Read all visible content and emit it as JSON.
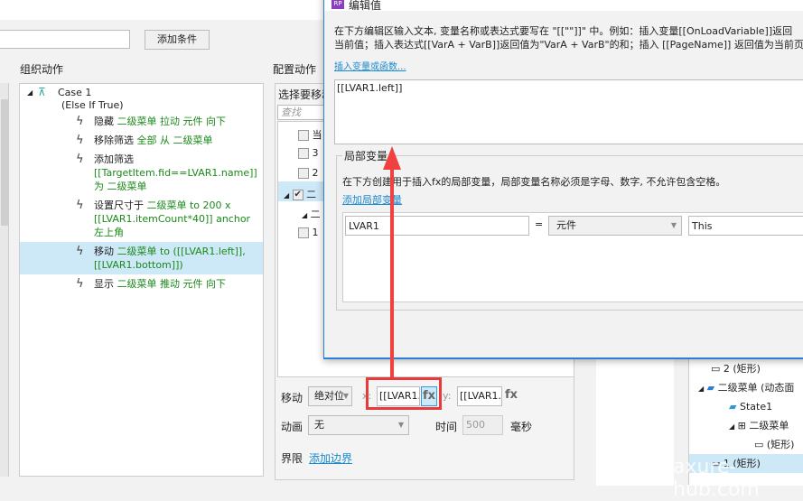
{
  "toolbar": {
    "add_condition": "添加条件"
  },
  "left": {
    "title": "组织动作",
    "case_title": "Case 1",
    "case_cond": "(Else If True)",
    "actions": [
      {
        "verb": "隐藏",
        "rest": "二级菜单 拉动 元件 向下",
        "rest2": ""
      },
      {
        "verb": "移除筛选",
        "rest": "全部 从 二级菜单",
        "rest2": ""
      },
      {
        "verb": "添加筛选",
        "rest": "[[TargetItem.fid==LVAR1.name]]",
        "rest2": "为 二级菜单"
      },
      {
        "verb": "设置尺寸于",
        "rest": "二级菜单 to 200 x",
        "rest2": "[[LVAR1.itemCount*40]] anchor 左上角"
      },
      {
        "verb": "移动",
        "rest": "二级菜单 to ([[LVAR1.left]],",
        "rest2": "[[LVAR1.bottom]])"
      },
      {
        "verb": "显示",
        "rest": "二级菜单 推动 元件 向下",
        "rest2": ""
      }
    ]
  },
  "config": {
    "title": "配置动作",
    "select_label": "选择要移动",
    "search_placeholder": "查找",
    "items": [
      "当",
      "3",
      "2",
      "二",
      "二",
      "1"
    ],
    "move_label": "移动",
    "move_mode": "绝对位",
    "x_label": "x:",
    "x_value": "[[LVAR1.",
    "fx": "fx",
    "y_label": "y:",
    "y_value": "[[LVAR1.",
    "anim_label": "动画",
    "anim_value": "无",
    "time_label": "时间",
    "time_value": "500",
    "ms_label": "毫秒",
    "bound_label": "界限",
    "add_bound": "添加边界"
  },
  "dialog": {
    "title": "编辑值",
    "logo": "RP",
    "desc1": "在下方编辑区输入文本, 变量名称或表达式要写在 \"[[\"\"]]\" 中。例如：插入变量[[OnLoadVariable]]返回",
    "desc2": "当前值；插入表达式[[VarA + VarB]]返回值为\"VarA + VarB\"的和；插入 [[PageName]] 返回值为当前页",
    "insert_link": "插入变量或函数...",
    "editor_value": "[[LVAR1.left]]",
    "local_title": "局部变量",
    "local_desc": "在下方创建用于插入fx的局部变量，局部变量名称必须是字母、数字, 不允许包含空格。",
    "add_local": "添加局部变量",
    "var_name": "LVAR1",
    "equals": "=",
    "var_type": "元件",
    "var_target": "This"
  },
  "outline": {
    "items": [
      "2 (矩形)",
      "二级菜单 (动态面",
      "State1",
      "二级菜单",
      "(矩形)",
      "1 (矩形)"
    ]
  },
  "watermark": "axure-hub.com",
  "colors": {
    "accent": "#2b7fd4",
    "highlight": "#e83a3a",
    "action_green": "#1a8a1a",
    "selection": "#cde8f6"
  }
}
